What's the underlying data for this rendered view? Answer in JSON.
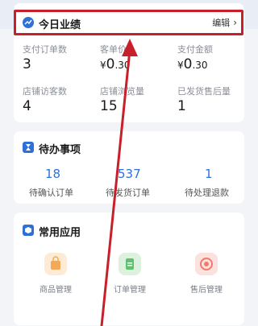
{
  "performance": {
    "title": "今日业绩",
    "edit_label": "编辑",
    "metrics": [
      {
        "label": "支付订单数",
        "value": "3"
      },
      {
        "label": "客单价",
        "currency": "¥",
        "int": "0",
        "dec": ".30"
      },
      {
        "label": "支付金额",
        "currency": "¥",
        "int": "0",
        "dec": ".30"
      },
      {
        "label": "店铺访客数",
        "value": "4"
      },
      {
        "label": "店铺浏览量",
        "value": "15"
      },
      {
        "label": "已发货售后量",
        "value": "1"
      }
    ]
  },
  "todo": {
    "title": "待办事项",
    "items": [
      {
        "count": "18",
        "label": "待确认订单"
      },
      {
        "count": "537",
        "label": "待发货订单"
      },
      {
        "count": "1",
        "label": "待处理退款"
      }
    ]
  },
  "apps": {
    "title": "常用应用",
    "items": [
      {
        "label": "商品管理",
        "icon": "bag-icon",
        "color": "#f3a95a"
      },
      {
        "label": "订单管理",
        "icon": "clipboard-icon",
        "color": "#5cc26c"
      },
      {
        "label": "售后管理",
        "icon": "refund-icon",
        "color": "#ef7b6c"
      }
    ]
  },
  "colors": {
    "accent": "#2f6fd8",
    "highlight": "#c8202a"
  }
}
